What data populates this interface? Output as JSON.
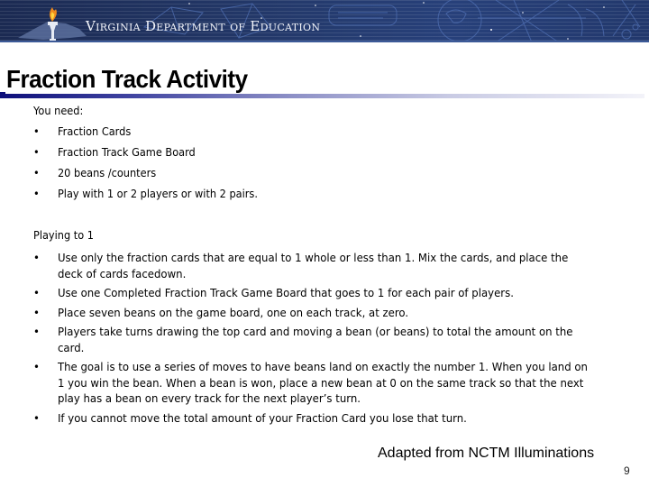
{
  "header": {
    "organization": "Virginia Department of Education",
    "logo_icon": "torch-over-virginia-map-icon"
  },
  "slide": {
    "title": "Fraction Track Activity",
    "you_need": {
      "heading": "You need:",
      "items": [
        "Fraction Cards",
        "Fraction Track Game Board",
        "20 beans /counters",
        "Play with 1 or 2 players or with 2 pairs."
      ]
    },
    "playing": {
      "heading": "Playing to 1",
      "items": [
        "Use only the fraction cards that are equal to 1 whole or less than 1. Mix the cards, and place the deck of cards facedown.",
        "Use one Completed Fraction Track Game Board that goes to 1 for each pair of players.",
        "Place seven beans on the game board, one on each track, at zero.",
        "Players take turns drawing the top card and moving a bean (or beans) to total the amount on the card.",
        "The goal is to use a series of moves to have beans land on exactly the number 1.  When you land on 1 you win the bean.  When a bean is won, place a new bean at 0 on the same track so that the next play has a bean on every track for the next player’s turn.",
        "If you cannot move the total amount of your Fraction Card you lose that turn."
      ]
    },
    "bullet_glyph": "•",
    "credit": "Adapted from NCTM Illuminations",
    "page_number": "9"
  }
}
